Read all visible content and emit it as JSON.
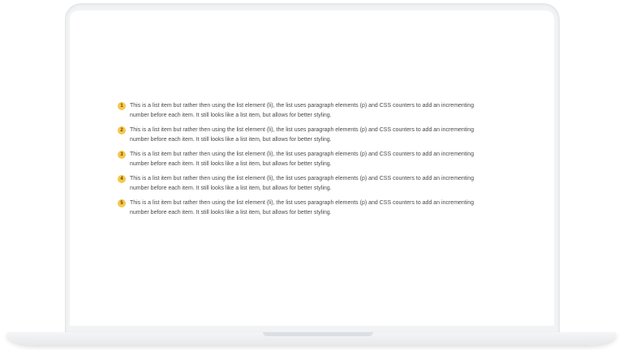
{
  "items": [
    {
      "number": "1",
      "line1": "This is a list item but rather then using the list element (li), the list uses paragraph elements (p) and CSS counters to add an incrementing",
      "line2": "number before each item. It still looks like a list item, but allows for better styling."
    },
    {
      "number": "2",
      "line1": "This is a list item but rather then using the list element (li), the list uses paragraph elements (p) and CSS counters to add an incrementing",
      "line2": "number before each item. It still looks like a list item, but allows for better styling."
    },
    {
      "number": "3",
      "line1": "This is a list item but rather then using the list element (li), the list uses paragraph elements (p) and CSS counters to add an incrementing",
      "line2": "number before each item. It still looks like a list item, but allows for better styling."
    },
    {
      "number": "4",
      "line1": "This is a list item but rather then using the list element (li), the list uses paragraph elements (p) and CSS counters to add an incrementing",
      "line2": "number before each item. It still looks like a list item, but allows for better styling."
    },
    {
      "number": "5",
      "line1": "This is a list item but rather then using the list element (li), the list uses paragraph elements (p) and CSS counters to add an incrementing",
      "line2": "number before each item. It still looks like a list item, but allows for better styling."
    }
  ],
  "colors": {
    "badge": "#f6c84c",
    "text": "#4a4a4a",
    "device": "#f2f3f5"
  }
}
